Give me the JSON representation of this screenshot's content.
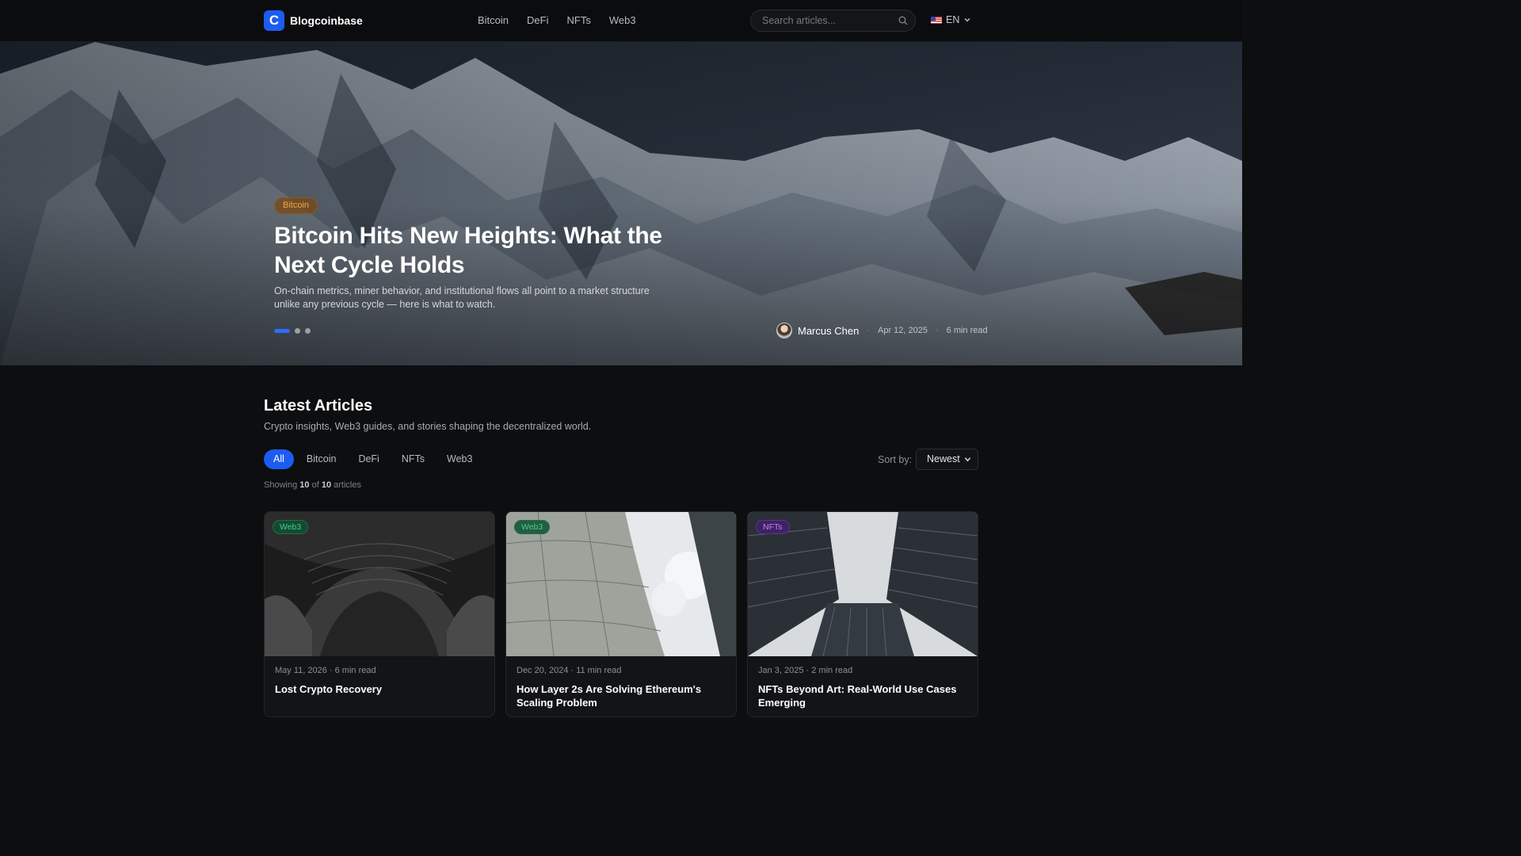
{
  "brand": {
    "logo_letter": "C",
    "name": "Blogcoinbase",
    "accent": "#1d5cf0"
  },
  "nav": {
    "links": [
      "Bitcoin",
      "DeFi",
      "NFTs",
      "Web3"
    ]
  },
  "search": {
    "placeholder": "Search articles..."
  },
  "language": {
    "label": "EN",
    "icon": "us-flag-icon"
  },
  "hero": {
    "tag": "Bitcoin",
    "title": "Bitcoin Hits New Heights: What the Next Cycle Holds",
    "subtitle": "On-chain metrics, miner behavior, and institutional flows all point to a market structure unlike any previous cycle — here is what to watch.",
    "author": "Marcus Chen",
    "date": "Apr 12, 2025",
    "read_time": "6 min read",
    "slide_count": 3,
    "active_slide": 1
  },
  "latest": {
    "title": "Latest Articles",
    "subtitle": "Crypto insights, Web3 guides, and stories shaping the decentralized world.",
    "filters": [
      "All",
      "Bitcoin",
      "DeFi",
      "NFTs",
      "Web3"
    ],
    "active_filter": "All",
    "sort_label": "Sort by:",
    "sort_value": "Newest",
    "showing_prefix": "Showing",
    "showing_count": "10",
    "showing_of": "of",
    "showing_total": "10",
    "showing_suffix": "articles"
  },
  "cards": [
    {
      "tag": "Web3",
      "meta": "May 11, 2026 · 6 min read",
      "title": "Lost Crypto Recovery"
    },
    {
      "tag": "Web3",
      "meta": "Dec 20, 2024 · 11 min read",
      "title": "How Layer 2s Are Solving Ethereum's Scaling Problem"
    },
    {
      "tag": "NFTs",
      "meta": "Jan 3, 2025 · 2 min read",
      "title": "NFTs Beyond Art: Real-World Use Cases Emerging"
    }
  ]
}
